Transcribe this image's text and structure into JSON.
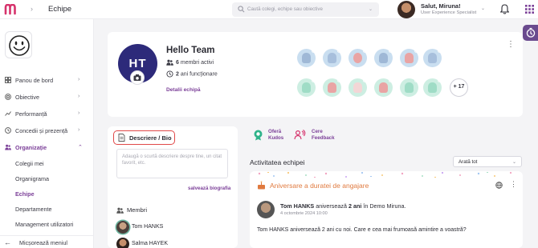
{
  "header": {
    "breadcrumb": "Echipe",
    "search_placeholder": "Caută colegi, echipe sau obiective",
    "user_name": "Salut, Miruna!",
    "user_role": "User Experience Specialist"
  },
  "sidebar": {
    "items": [
      {
        "label": "Panou de bord",
        "expanded": false
      },
      {
        "label": "Obiective",
        "expanded": false
      },
      {
        "label": "Performanță",
        "expanded": false
      },
      {
        "label": "Concedii și prezență",
        "expanded": false
      },
      {
        "label": "Organizație",
        "expanded": true
      }
    ],
    "subitems": [
      {
        "label": "Colegii mei"
      },
      {
        "label": "Organigrama"
      },
      {
        "label": "Echipe"
      },
      {
        "label": "Departamente"
      },
      {
        "label": "Management utilizatori"
      }
    ],
    "collapse_label": "Micșorează meniul"
  },
  "team": {
    "initials": "HT",
    "name": "Hello Team",
    "members_count": "6",
    "members_text": "membri activi",
    "years_count": "2",
    "years_text": "ani funcționare",
    "details_link": "Detalii echipă",
    "more_members": "+ 17"
  },
  "bio": {
    "title": "Descriere / Bio",
    "placeholder": "Adaugă o scurtă descriere despre tine, un citat favorit, etc.",
    "save_link": "salvează biografia",
    "members_heading": "Membri",
    "members": [
      {
        "name": "Tom HANKS"
      },
      {
        "name": "Salma HAYEK"
      }
    ]
  },
  "actions": {
    "kudos_line1": "Oferă",
    "kudos_line2": "Kudos",
    "feedback_line1": "Cere",
    "feedback_line2": "Feedback"
  },
  "activity": {
    "title": "Activitatea echipei",
    "filter_value": "Arată tot",
    "event_title": "Aniversare a duratei de angajare",
    "post_name": "Tom HANKS",
    "post_verb": "aniversează",
    "post_years": "2 ani",
    "post_in": "în",
    "post_company": "Demo Miruna.",
    "post_date": "4 octombrie 2024 10:00",
    "post_body": "Tom HANKS aniversează 2 ani cu noi. Care e cea mai frumoasă amintire a voastră?"
  },
  "colors": {
    "accent": "#7b3f98",
    "team_avatar": "#2d2a7a",
    "highlight_border": "#e04848",
    "anniversary": "#e07a3f"
  }
}
